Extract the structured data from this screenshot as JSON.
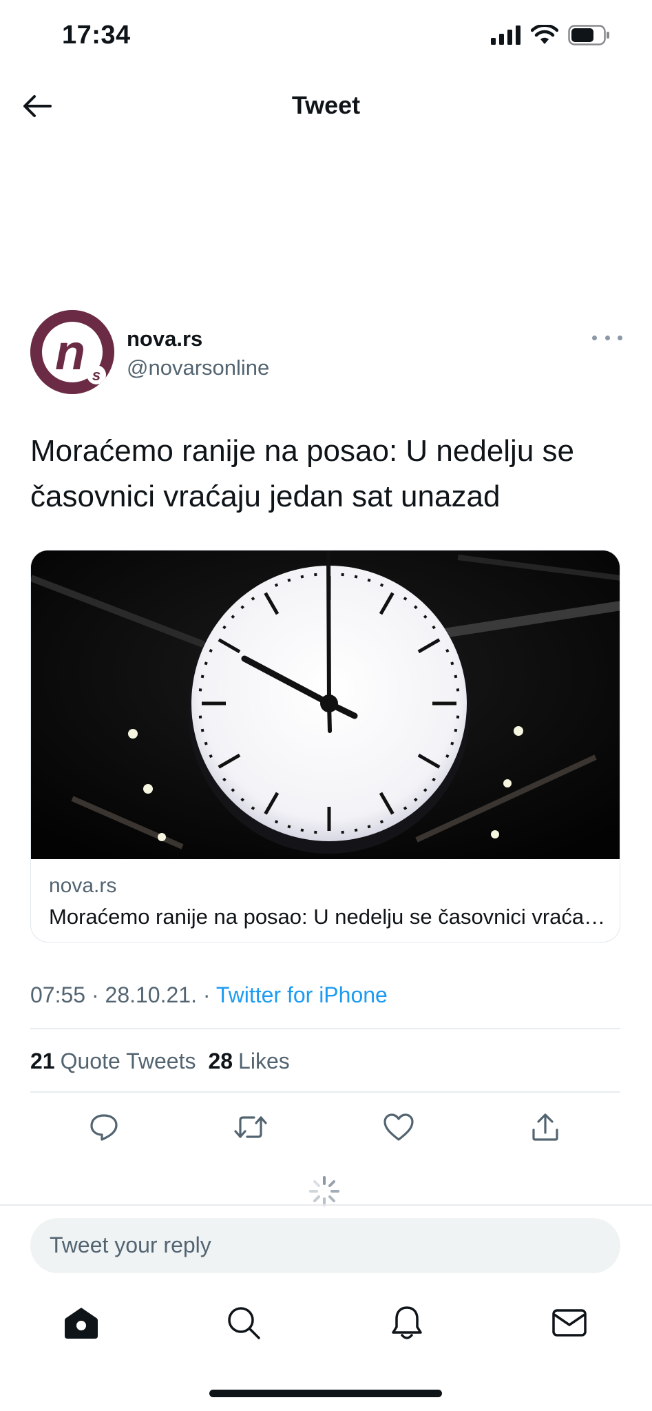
{
  "status_bar": {
    "time": "17:34",
    "icons": [
      "signal-icon",
      "wifi-icon",
      "battery-icon"
    ]
  },
  "header": {
    "title": "Tweet",
    "back_icon": "arrow-left-icon"
  },
  "tweet": {
    "author": {
      "name": "nova.rs",
      "handle": "@novarsonline",
      "avatar_color": "#6b2b45"
    },
    "more_icon": "more-horizontal-icon",
    "text": "Moraćemo ranije na posao: U nedelju se časovnici vraćaju jedan sat unazad",
    "card": {
      "image_icon": "clock-photo",
      "domain": "nova.rs",
      "title": "Moraćemo ranije na posao: U nedelju se časovnici vraćaju jedan sat unazad"
    },
    "time": "07:55",
    "sep1": " · ",
    "date": "28.10.21.",
    "sep2": " · ",
    "source": "Twitter for iPhone",
    "stats": {
      "quote_tweets_count": "21",
      "quote_tweets_label": "Quote Tweets",
      "likes_count": "28",
      "likes_label": "Likes"
    },
    "actions": [
      "reply-icon",
      "retweet-icon",
      "like-icon",
      "share-icon"
    ]
  },
  "reply": {
    "placeholder": "Tweet your reply"
  },
  "tab_bar": [
    "home-icon",
    "search-icon",
    "notifications-icon",
    "messages-icon"
  ],
  "colors": {
    "accent": "#1d9bf0",
    "text_primary": "#0f1419",
    "text_secondary": "#536471"
  }
}
